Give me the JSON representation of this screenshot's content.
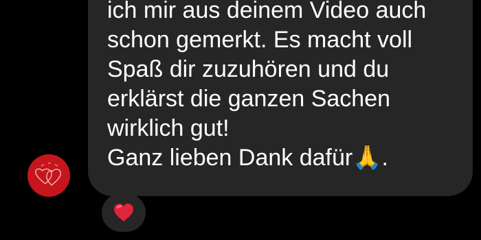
{
  "message": {
    "text": "ich mir aus deinem Video auch\nschon gemerkt. Es macht voll\nSpaß dir zuzuhören und du\nerklärst die ganzen Sachen\nwirklich gut!\nGanz lieben Dank dafür🙏."
  },
  "reaction": {
    "icon": "red-heart-icon"
  },
  "avatar": {
    "icon": "hearts-logo-icon",
    "color": "#c4161c"
  },
  "colors": {
    "background": "#000000",
    "bubble": "#262626",
    "text": "#ffffff",
    "heart": "#e0243b"
  }
}
